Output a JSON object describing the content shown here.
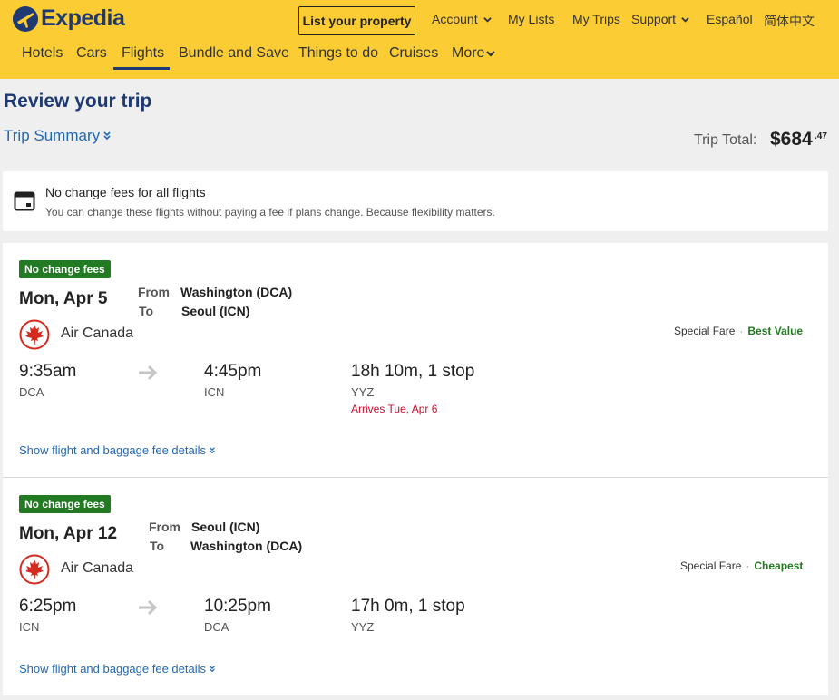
{
  "header": {
    "logo_text": "Expedia",
    "list_property": "List your property",
    "top_links": {
      "account": "Account",
      "my_lists": "My Lists",
      "my_trips": "My Trips",
      "support": "Support",
      "espanol": "Español",
      "chinese": "简体中文"
    },
    "nav": {
      "hotels": "Hotels",
      "cars": "Cars",
      "flights": "Flights",
      "bundle": "Bundle and Save",
      "things": "Things to do",
      "cruises": "Cruises",
      "more": "More"
    },
    "active_nav": "Flights"
  },
  "review": {
    "title": "Review your trip",
    "trip_summary": "Trip Summary",
    "trip_total_label": "Trip Total:",
    "trip_total_amount": "$684",
    "trip_total_cents": ".47"
  },
  "notice": {
    "icon": "calendar-icon",
    "title": "No change fees for all flights",
    "subtitle": "You can change these flights without paying a fee if plans change. Because flexibility matters."
  },
  "flights": [
    {
      "badge": "No change fees",
      "date": "Mon, Apr 5",
      "from_label": "From",
      "to_label": "To",
      "from_city": "Washington (DCA)",
      "to_city": "Seoul (ICN)",
      "airline": "Air Canada",
      "fare_type": "Special Fare",
      "fare_tag": "Best Value",
      "depart_time": "9:35am",
      "depart_code": "DCA",
      "arrive_time": "4:45pm",
      "arrive_code": "ICN",
      "duration": "18h 10m, 1 stop",
      "stop_code": "YYZ",
      "arrives_note": "Arrives Tue, Apr 6",
      "details_link": "Show flight and baggage fee details"
    },
    {
      "badge": "No change fees",
      "date": "Mon, Apr 12",
      "from_label": "From",
      "to_label": "To",
      "from_city": "Seoul (ICN)",
      "to_city": "Washington (DCA)",
      "airline": "Air Canada",
      "fare_type": "Special Fare",
      "fare_tag": "Cheapest",
      "depart_time": "6:25pm",
      "depart_code": "ICN",
      "arrive_time": "10:25pm",
      "arrive_code": "DCA",
      "duration": "17h 0m, 1 stop",
      "stop_code": "YYZ",
      "details_link": "Show flight and baggage fee details"
    }
  ],
  "colors": {
    "header_bg": "#fbcc33",
    "brand_navy": "#1f3a73",
    "link_blue": "#2368b3",
    "badge_green": "#227a22",
    "alert_red": "#c8102e"
  }
}
